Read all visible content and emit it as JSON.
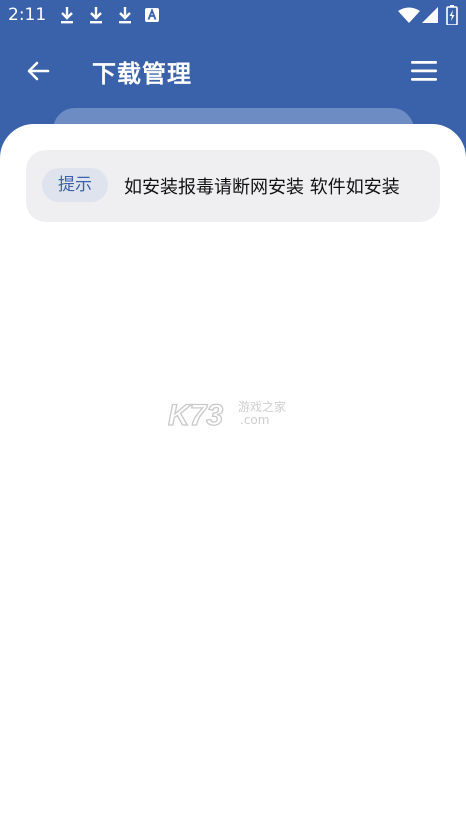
{
  "status_bar": {
    "time": "2:11",
    "left_icons": [
      "download-icon",
      "download-icon",
      "download-icon",
      "a-box-icon"
    ],
    "right_icons": [
      "wifi-icon",
      "signal-icon",
      "battery-icon"
    ]
  },
  "app_bar": {
    "title": "下载管理",
    "back_icon": "arrow-left-icon",
    "menu_icon": "hamburger-menu-icon"
  },
  "notice": {
    "badge": "提示",
    "marquee": "如安装报毒请断网安装   软件如安装"
  },
  "watermark": {
    "logo_text": "K73",
    "subtitle": "游戏之家",
    "domain": ".com"
  },
  "colors": {
    "primary": "#3a62aa",
    "notice_bg": "#efeff1",
    "badge_bg": "#dfe3ee"
  }
}
